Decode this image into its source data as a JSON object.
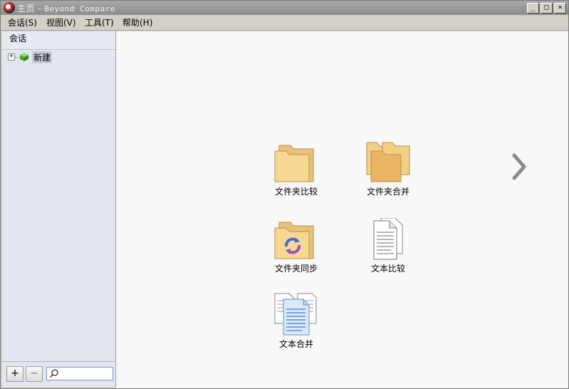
{
  "window": {
    "title_page": "主页",
    "title_sep": " - ",
    "title_app": "Beyond Compare"
  },
  "window_controls": {
    "minimize": "_",
    "maximize": "□",
    "close": "×"
  },
  "menu": [
    "会话(S)",
    "视图(V)",
    "工具(T)",
    "帮助(H)"
  ],
  "sidebar": {
    "header": "会话",
    "tree": [
      {
        "expander": "+",
        "label": "新建"
      }
    ],
    "footer": {
      "add": "+",
      "remove": "−",
      "search_placeholder": ""
    }
  },
  "launchers": [
    {
      "label": "文件夹比较",
      "icon": "folder-compare-icon"
    },
    {
      "label": "文件夹合并",
      "icon": "folder-merge-icon"
    },
    {
      "label": "文件夹同步",
      "icon": "folder-sync-icon"
    },
    {
      "label": "文本比较",
      "icon": "text-compare-icon"
    },
    {
      "label": "文本合并",
      "icon": "text-merge-icon"
    }
  ],
  "colors": {
    "folder": "#f2cf85",
    "folder_dark": "#e2ae56",
    "sync_blue": "#3a6fd8",
    "sync_purple": "#9a4fc8",
    "doc_lines": "#8a8a8a",
    "merge_blue": "#5b8fd0"
  }
}
